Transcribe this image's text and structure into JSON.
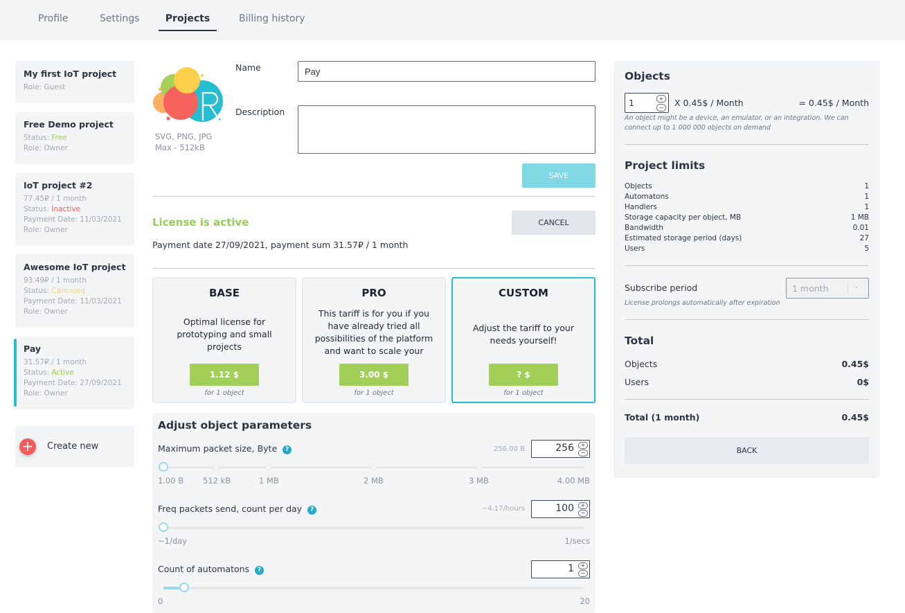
{
  "tabs": [
    {
      "label": "Profile",
      "active": false
    },
    {
      "label": "Settings",
      "active": false
    },
    {
      "label": "Projects",
      "active": true
    },
    {
      "label": "Billing history",
      "active": false
    }
  ],
  "projects": [
    {
      "title": "My first IoT project",
      "role": "Role: Guest"
    },
    {
      "title": "Free Demo project",
      "status_prefix": "Status: ",
      "status": "Free",
      "role": "Role: Owner"
    },
    {
      "title": "IoT project #2",
      "price": "77.45₽ / 1 month",
      "status_prefix": "Status: ",
      "status": "Inactive",
      "payment": "Payment Date: 11/03/2021",
      "role": "Role: Owner"
    },
    {
      "title": "Awesome IoT project",
      "price": "93.49₽ / 1 month",
      "status_prefix": "Status: ",
      "status": "Canceled",
      "payment": "Payment Date: 11/03/2021",
      "role": "Role: Owner"
    },
    {
      "title": "Pay",
      "price": "31.57₽ / 1 month",
      "status_prefix": "Status: ",
      "status": "Active",
      "payment": "Payment Date: 27/09/2021",
      "role": "Role: Owner",
      "selected": true
    }
  ],
  "create_new": {
    "icon": "+",
    "label": "Create new"
  },
  "form": {
    "logo_hint_1": "SVG, PNG, JPG",
    "logo_hint_2": "Max - 512kB",
    "name_label": "Name",
    "name_value": "Pay",
    "description_label": "Description",
    "description_value": "",
    "save_label": "SAVE"
  },
  "license": {
    "title": "License is active",
    "cancel_label": "CANCEL",
    "payment_info": "Payment date 27/09/2021, payment sum 31.57₽ / 1 month"
  },
  "tariffs": [
    {
      "name": "BASE",
      "description": "Optimal license for prototyping and small projects",
      "price": "1.12 $",
      "note": "for 1 object",
      "selected": false
    },
    {
      "name": "PRO",
      "description": "This tariff is for you if you have already tried all possibilities of the platform and want to scale your",
      "price": "3.00 $",
      "note": "for 1 object",
      "selected": false
    },
    {
      "name": "CUSTOM",
      "description": "Adjust the tariff to your needs yourself!",
      "price": "? $",
      "note": "for 1 object",
      "selected": true
    }
  ],
  "params": {
    "title": "Adjust object parameters",
    "help_icon": "?",
    "packet_size": {
      "label": "Maximum packet size, Byte",
      "hint": "256.00 B",
      "value": "256",
      "slider_fraction": 0.0,
      "ticks": [
        "1.00 B",
        "512 kB",
        "1 MB",
        "2 MB",
        "3 MB",
        "4.00 MB"
      ]
    },
    "freq": {
      "label": "Freq packets send, count per day",
      "hint": "~4.17/hours",
      "value": "100",
      "slider_fraction": 0.0,
      "min_label": "~1/day",
      "max_label": "1/secs"
    },
    "automatons": {
      "label": "Count of automatons",
      "value": "1",
      "slider_value": 1,
      "slider_max": 20,
      "min_label": "0",
      "max_label": "20"
    }
  },
  "objects": {
    "title": "Objects",
    "count": "1",
    "unit_price": "X 0.45$ / Month",
    "result": "= 0.45$ / Month",
    "note": "An object might be a device, an emulator, or an integration. We can connect up to 1 000 000 objects on demand"
  },
  "limits": {
    "title": "Project limits",
    "rows": [
      {
        "label": "Objects",
        "value": "1"
      },
      {
        "label": "Automatons",
        "value": "1"
      },
      {
        "label": "Handlers",
        "value": "1"
      },
      {
        "label": "Storage capacity per object, MB",
        "value": "1 MB"
      },
      {
        "label": "Bandwidth",
        "value": "0.01"
      },
      {
        "label": "Estimated storage period (days)",
        "value": "27"
      },
      {
        "label": "Users",
        "value": "5"
      }
    ]
  },
  "subscribe": {
    "label": "Subscribe period",
    "value": "1 month",
    "note": "License prolongs automatically after expiration"
  },
  "total": {
    "title": "Total",
    "rows": [
      {
        "label": "Objects",
        "value": "0.45$"
      },
      {
        "label": "Users",
        "value": "0$"
      }
    ],
    "grand_label": "Total (1 month)",
    "grand_value": "0.45$",
    "back_label": "BACK"
  },
  "colors": {
    "accent": "#27bdd1",
    "green": "#a1cf58",
    "status_free": "#99cc55",
    "status_inactive": "#f25c5c",
    "status_canceled": "#f4d56a",
    "status_active": "#99cc55"
  }
}
